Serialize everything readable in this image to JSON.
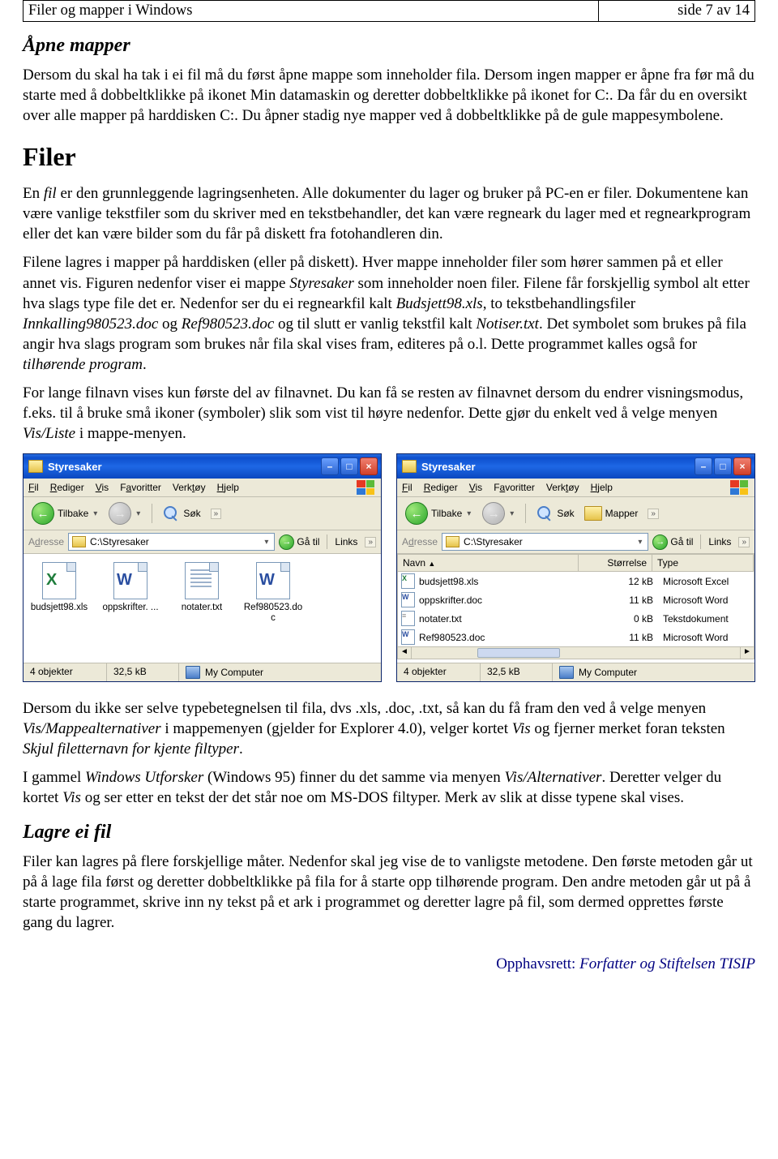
{
  "header": {
    "left": "Filer og mapper i Windows",
    "right": "side 7 av 14"
  },
  "h_apne": "Åpne mapper",
  "p_apne": "Dersom du skal ha tak i ei fil må du først åpne mappe som inneholder fila. Dersom ingen mapper er åpne fra før må du starte med å dobbeltklikke på ikonet Min datamaskin og deretter dobbeltklikke på ikonet for C:. Da får du en oversikt over alle mapper på harddisken C:. Du åpner stadig nye mapper ved å dobbeltklikke på de gule mappesymbolene.",
  "h_filer": "Filer",
  "p_filer1_a": "En ",
  "p_filer1_it": "fil",
  "p_filer1_b": " er den grunnleggende lagringsenheten. Alle dokumenter du lager og bruker på PC-en er filer. Dokumentene kan være vanlige tekstfiler som du skriver med en tekstbehandler, det kan være regneark du lager med et regnearkprogram eller det kan være bilder som du får på diskett fra fotohandleren din.",
  "p_filer2_a": "Filene lagres i mapper på harddisken (eller på diskett). Hver mappe inneholder filer som hører sammen på et eller annet vis. Figuren nedenfor viser ei mappe ",
  "p_filer2_it1": "Styresaker",
  "p_filer2_b": " som inneholder noen filer. Filene får forskjellig symbol alt etter hva slags type file det er. Nedenfor ser du ei regnearkfil kalt ",
  "p_filer2_it2": "Budsjett98.xls",
  "p_filer2_c": ", to tekstbehandlingsfiler ",
  "p_filer2_it3": "Innkalling980523.doc",
  "p_filer2_d": " og ",
  "p_filer2_it4": "Ref980523.doc",
  "p_filer2_e": " og til slutt er vanlig tekstfil kalt ",
  "p_filer2_it5": "Notiser.txt",
  "p_filer2_f": ". Det symbolet som brukes på fila angir hva slags program som brukes når fila skal vises fram, editeres på o.l. Dette programmet kalles også for ",
  "p_filer2_it6": "tilhørende program",
  "p_filer2_g": ".",
  "p_filer3_a": "For lange filnavn vises kun første del av filnavnet. Du kan få se resten av filnavnet dersom du endrer visningsmodus, f.eks. til å bruke små ikoner (symboler) slik som vist til høyre nedenfor. Dette gjør du enkelt ved å velge menyen ",
  "p_filer3_it": "Vis/Liste",
  "p_filer3_b": " i mappe-menyen.",
  "p_after1_a": "Dersom du ikke ser selve typebetegnelsen til fila, dvs .xls, .doc, .txt, så kan du få fram den ved å velge menyen ",
  "p_after1_it1": "Vis/Mappealternativer",
  "p_after1_b": " i mappemenyen (gjelder for Explorer 4.0), velger kortet ",
  "p_after1_it2": "Vis",
  "p_after1_c": " og fjerner merket foran teksten ",
  "p_after1_it3": "Skjul filetternavn for kjente filtyper",
  "p_after1_d": ".",
  "p_after2_a": "I gammel ",
  "p_after2_it1": "Windows Utforsker",
  "p_after2_b": " (Windows 95) finner du det samme via menyen ",
  "p_after2_it2": "Vis/Alternativer",
  "p_after2_c": ". Deretter velger du kortet ",
  "p_after2_it3": "Vis",
  "p_after2_d": " og ser etter en tekst der det står noe om MS-DOS filtyper. Merk av slik at disse typene skal vises.",
  "h_lagre": "Lagre ei fil",
  "p_lagre": "Filer kan lagres på flere forskjellige måter. Nedenfor skal jeg vise de to vanligste metodene. Den første metoden går ut på å lage fila først og deretter dobbeltklikke på fila for å starte opp tilhørende program. Den andre metoden går ut på å starte programmet, skrive inn ny tekst på et ark i programmet og deretter lagre på fil, som dermed opprettes første gang du lagrer.",
  "footer_a": "Opphavsrett:  ",
  "footer_it": "Forfatter og Stiftelsen TISIP",
  "win": {
    "title": "Styresaker",
    "menu": {
      "fil": "Fil",
      "rediger": "Rediger",
      "vis": "Vis",
      "favoritter": "Favoritter",
      "verktoy": "Verktøy",
      "hjelp": "Hjelp"
    },
    "tb": {
      "tilbake": "Tilbake",
      "sok": "Søk",
      "mapper": "Mapper"
    },
    "addr_label": "Adresse",
    "addr_path": "C:\\Styresaker",
    "go": "Gå til",
    "links": "Links",
    "status": {
      "objects": "4 objekter",
      "size": "32,5 kB",
      "loc": "My Computer"
    },
    "icons": {
      "f1": "budsjett98.xls",
      "f2": "oppskrifter. ...",
      "f3": "notater.txt",
      "f4a": "Ref980523.do",
      "f4b": "c"
    },
    "list": {
      "hdr_name": "Navn",
      "hdr_size": "Størrelse",
      "hdr_type": "Type",
      "r1": {
        "name": "budsjett98.xls",
        "size": "12 kB",
        "type": "Microsoft Excel"
      },
      "r2": {
        "name": "oppskrifter.doc",
        "size": "11 kB",
        "type": "Microsoft Word"
      },
      "r3": {
        "name": "notater.txt",
        "size": "0 kB",
        "type": "Tekstdokument"
      },
      "r4": {
        "name": "Ref980523.doc",
        "size": "11 kB",
        "type": "Microsoft Word"
      }
    }
  }
}
